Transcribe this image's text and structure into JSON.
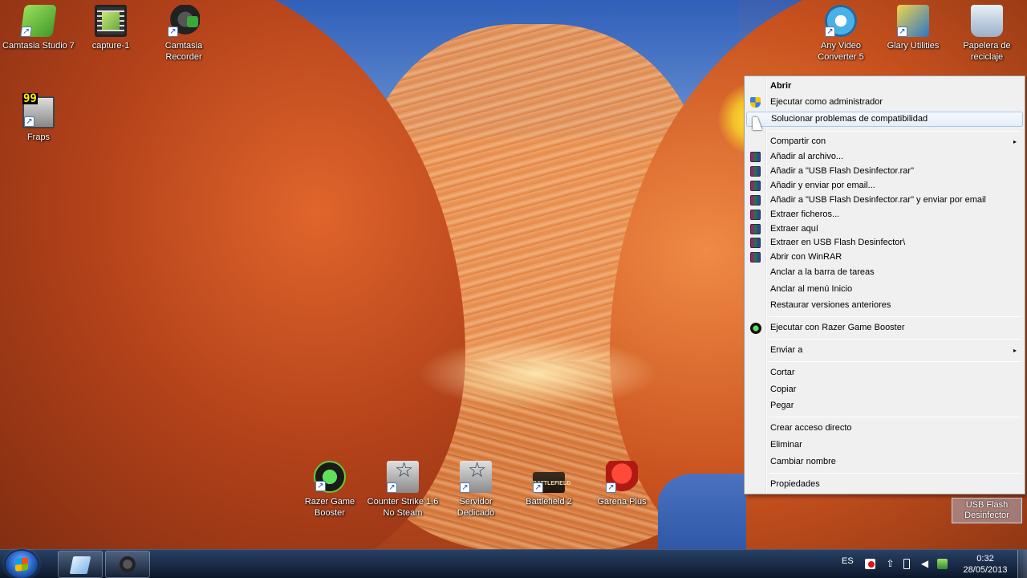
{
  "desktop": {
    "icons": [
      {
        "label": "Camtasia Studio 7",
        "icon": "camtasia-icon"
      },
      {
        "label": "capture-1",
        "icon": "film-icon"
      },
      {
        "label": "Camtasia Recorder",
        "icon": "camera-icon"
      },
      {
        "label": "Fraps",
        "icon": "fraps-icon",
        "badge": "99"
      },
      {
        "label": "Any Video Converter 5",
        "icon": "any-video-converter-icon"
      },
      {
        "label": "Glary Utilities",
        "icon": "glary-utilities-icon"
      },
      {
        "label": "Papelera de reciclaje",
        "icon": "recycle-bin-icon"
      },
      {
        "label": "Razer Game Booster",
        "icon": "razer-icon"
      },
      {
        "label": "Counter Strike 1.6 No Steam",
        "icon": "counter-strike-icon"
      },
      {
        "label": "Servidor Dedicado",
        "icon": "counter-strike-server-icon"
      },
      {
        "label": "Battlefield 2",
        "icon": "battlefield-icon"
      },
      {
        "label": "Garena Plus",
        "icon": "garena-icon"
      }
    ],
    "selected_item_label": "USB Flash Desinfector"
  },
  "context_menu": {
    "items": [
      {
        "label": "Abrir",
        "bold": true
      },
      {
        "label": "Ejecutar como administrador",
        "icon": "uac-shield-icon"
      },
      {
        "label": "Solucionar problemas de compatibilidad",
        "hovered": true
      },
      {
        "label": "Compartir con",
        "submenu": true
      },
      {
        "label": "Añadir al archivo...",
        "icon": "winrar-icon"
      },
      {
        "label": "Añadir a \"USB Flash Desinfector.rar\"",
        "icon": "winrar-icon"
      },
      {
        "label": "Añadir y enviar por email...",
        "icon": "winrar-icon"
      },
      {
        "label": "Añadir a \"USB Flash Desinfector.rar\" y enviar por email",
        "icon": "winrar-icon"
      },
      {
        "label": "Extraer ficheros...",
        "icon": "winrar-icon"
      },
      {
        "label": "Extraer aquí",
        "icon": "winrar-icon"
      },
      {
        "label": "Extraer en USB Flash Desinfector\\",
        "icon": "winrar-icon"
      },
      {
        "label": "Abrir con WinRAR",
        "icon": "winrar-icon"
      },
      {
        "label": "Anclar a la barra de tareas"
      },
      {
        "label": "Anclar al menú Inicio"
      },
      {
        "label": "Restaurar versiones anteriores"
      },
      {
        "label": "Ejecutar con Razer Game Booster",
        "icon": "razer-icon"
      },
      {
        "label": "Enviar a",
        "submenu": true
      },
      {
        "label": "Cortar"
      },
      {
        "label": "Copiar"
      },
      {
        "label": "Pegar"
      },
      {
        "label": "Crear acceso directo"
      },
      {
        "label": "Eliminar"
      },
      {
        "label": "Cambiar nombre"
      },
      {
        "label": "Propiedades"
      }
    ],
    "submenu_arrow": "▸"
  },
  "taskbar": {
    "pinned": [
      {
        "name": "windows-explorer",
        "icon": "explorer-icon"
      },
      {
        "name": "camtasia-recorder",
        "icon": "camtasia-recorder-icon"
      }
    ],
    "tray": {
      "language": "ES",
      "clock_time": "0:32",
      "clock_date": "28/05/2013"
    }
  },
  "colors": {
    "menu_bg": "#f0f0f0",
    "menu_hover": "#e5eef9",
    "taskbar": "#14202f",
    "cursor_highlight": "#ffe628"
  }
}
